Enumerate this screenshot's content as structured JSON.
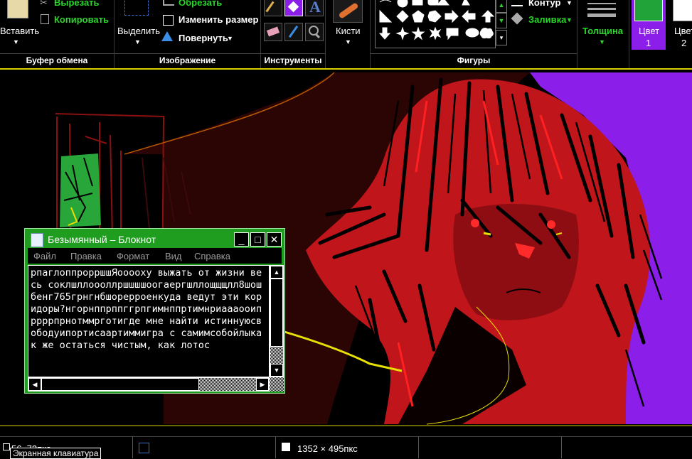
{
  "ribbon": {
    "clipboard": {
      "paste_label": "Вставить",
      "cut_label": "Вырезать",
      "copy_label": "Копировать",
      "group_label": "Буфер обмена"
    },
    "image": {
      "select_label": "Выделить",
      "crop_label": "Обрезать",
      "resize_label": "Изменить размер",
      "rotate_label": "Повернуть",
      "group_label": "Изображение"
    },
    "tools": {
      "group_label": "Инструменты"
    },
    "brushes": {
      "label": "Кисти"
    },
    "shapes": {
      "outline_label": "Контур",
      "fill_label": "Заливка",
      "group_label": "Фигуры"
    },
    "size": {
      "label": "Толщина"
    },
    "color1": {
      "label": "Цвет",
      "number": "1",
      "swatch": "#22a33a"
    },
    "color2": {
      "label": "Цвет",
      "number": "2"
    }
  },
  "notepad": {
    "title": "Безымянный – Блокнот",
    "menu": [
      "Файл",
      "Правка",
      "Формат",
      "Вид",
      "Справка"
    ],
    "content": "рпаглоппрорршшЯооооху выжать от жизни весь соклшллоооллршшшшоогаергшллощщщлл8шошбенг765грнгнбшорерроенкуда ведут эти коридоры?нгорнппрппггрпгимнппртимнриаааооипррррпрнотммрготигде мне найти истиннуюсвободуипортисаартиммигра с самимсобойлыкак же остаться чистым, как лотос"
  },
  "status": {
    "position": "56, 73пкс",
    "canvas_size": "1352 × 495пкс",
    "tooltip": "Экранная клавиатура"
  },
  "colors": {
    "accent_green": "#2bd52b",
    "selection_yellow": "#d8d000",
    "purple": "#8b1ee8",
    "maroon": "#2b0404"
  }
}
